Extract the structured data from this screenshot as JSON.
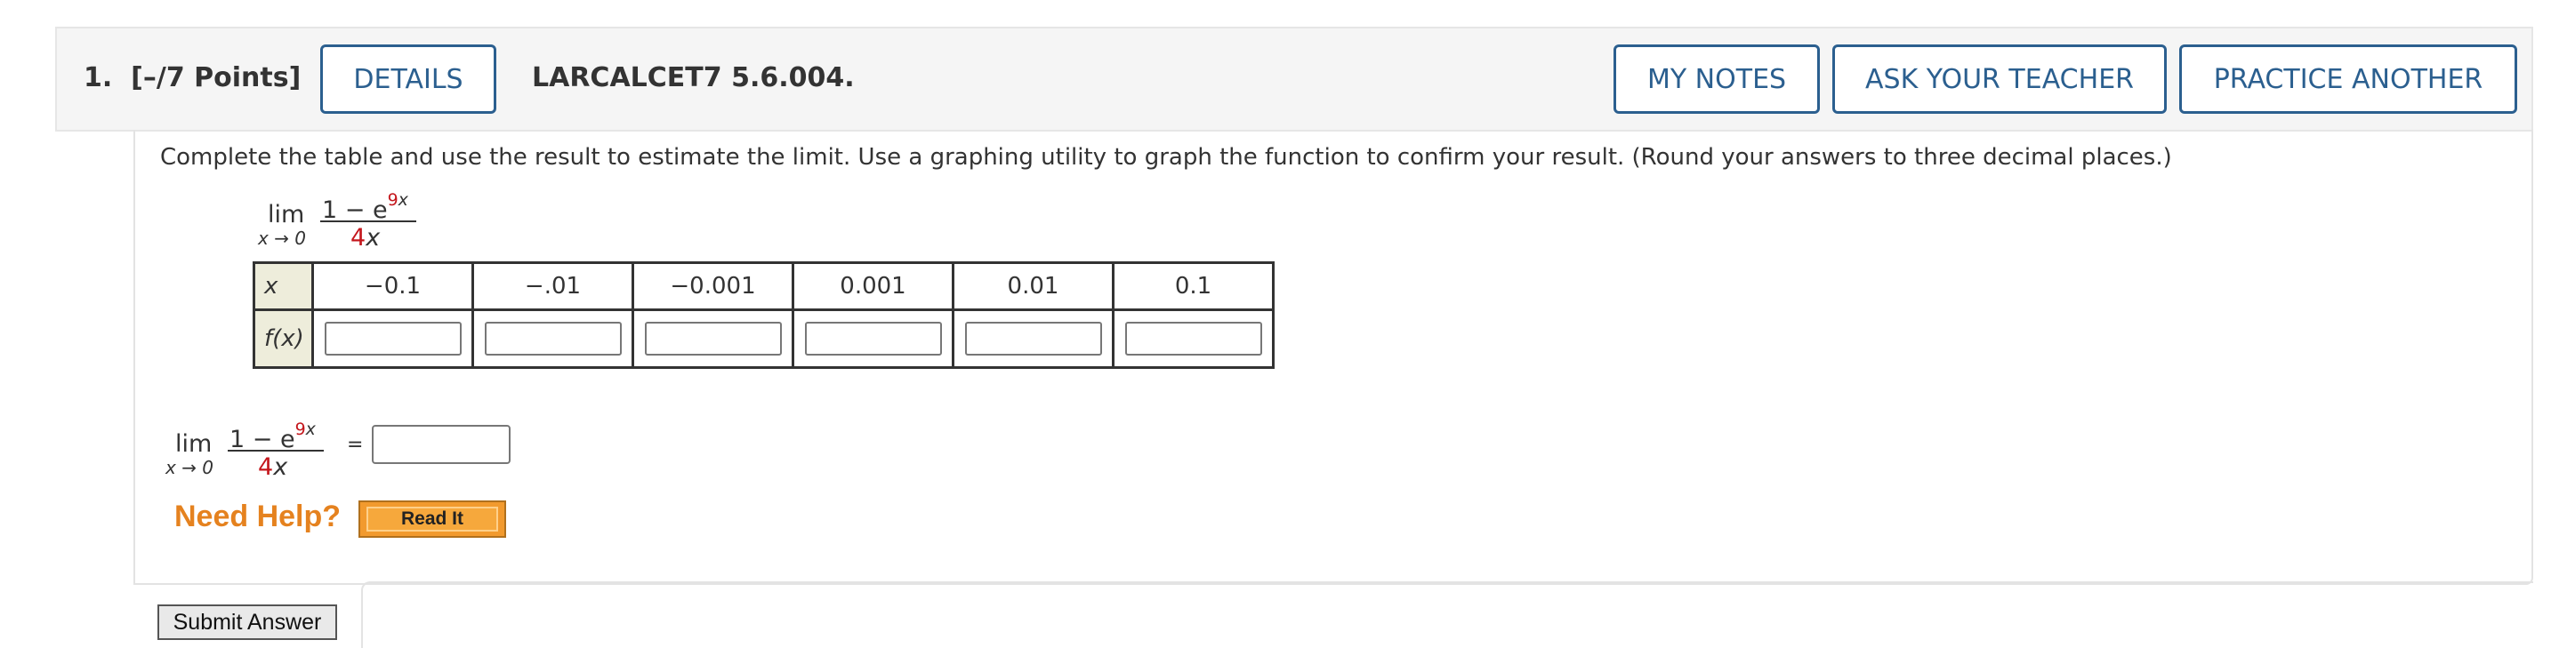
{
  "header": {
    "question_number": "1.",
    "points": "[–/7 Points]",
    "details_label": "DETAILS",
    "reference": "LARCALCET7 5.6.004.",
    "my_notes_label": "MY NOTES",
    "ask_teacher_label": "ASK YOUR TEACHER",
    "practice_label": "PRACTICE ANOTHER"
  },
  "prompt": "Complete the table and use the result to estimate the limit. Use a graphing utility to graph the function to confirm your result. (Round your answers to three decimal places.)",
  "limit": {
    "lim": "lim",
    "approach": "x → 0",
    "numerator_base": "1 − e",
    "numerator_exp_num": "9",
    "numerator_exp_var": "x",
    "denominator_coef": "4",
    "denominator_var": "x"
  },
  "table": {
    "x_header": "x",
    "fx_header": "f(x)",
    "x_values": [
      "−0.1",
      "−.01",
      "−0.001",
      "0.001",
      "0.01",
      "0.1"
    ]
  },
  "equals": "=",
  "help": {
    "label": "Need Help?",
    "read_it": "Read It"
  },
  "submit_label": "Submit Answer"
}
